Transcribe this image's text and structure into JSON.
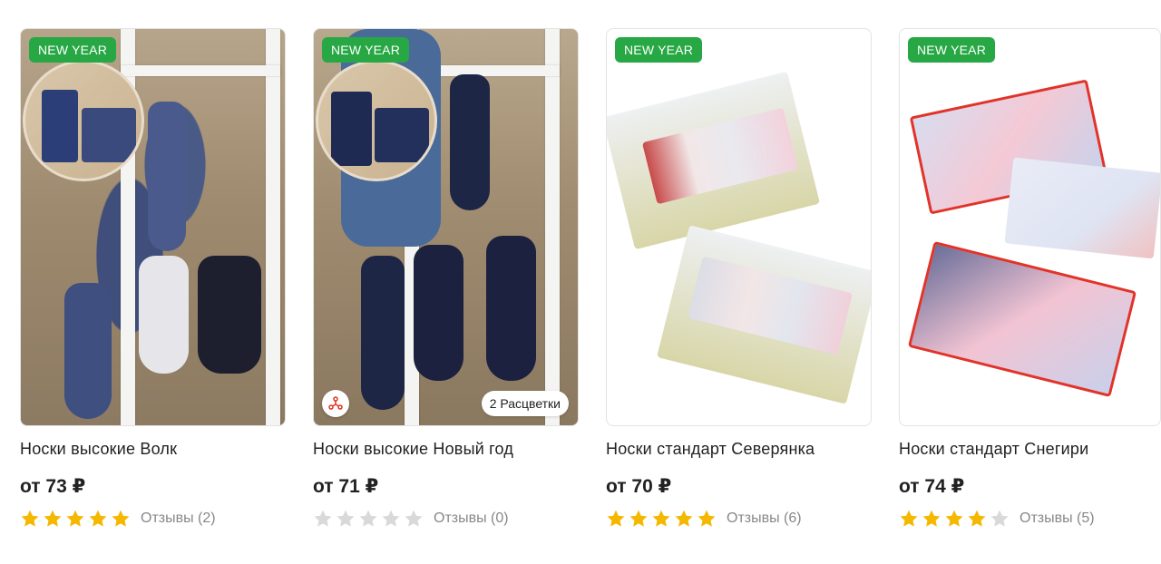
{
  "colors": {
    "badge": "#27a844",
    "star_filled": "#f5b800",
    "star_empty": "#d9d9d9",
    "share": "#e0341e"
  },
  "products": [
    {
      "badge": "NEW YEAR",
      "title": "Носки высокие Волк",
      "price": "от 73 ₽",
      "rating": 5,
      "reviews": "Отзывы (2)",
      "image_icon": "socks-photo-icon"
    },
    {
      "badge": "NEW YEAR",
      "title": "Носки высокие Новый год",
      "price": "от 71 ₽",
      "rating": 0,
      "reviews": "Отзывы (0)",
      "variants": "2 Расцветки",
      "image_icon": "socks-photo-icon",
      "share_icon": "share-icon"
    },
    {
      "badge": "NEW YEAR",
      "title": "Носки стандарт Северянка",
      "price": "от 70 ₽",
      "rating": 5,
      "reviews": "Отзывы (6)",
      "image_icon": "gift-box-icon"
    },
    {
      "badge": "NEW YEAR",
      "title": "Носки стандарт Снегири",
      "price": "от 74 ₽",
      "rating": 4,
      "reviews": "Отзывы (5)",
      "image_icon": "gift-box-icon"
    }
  ]
}
